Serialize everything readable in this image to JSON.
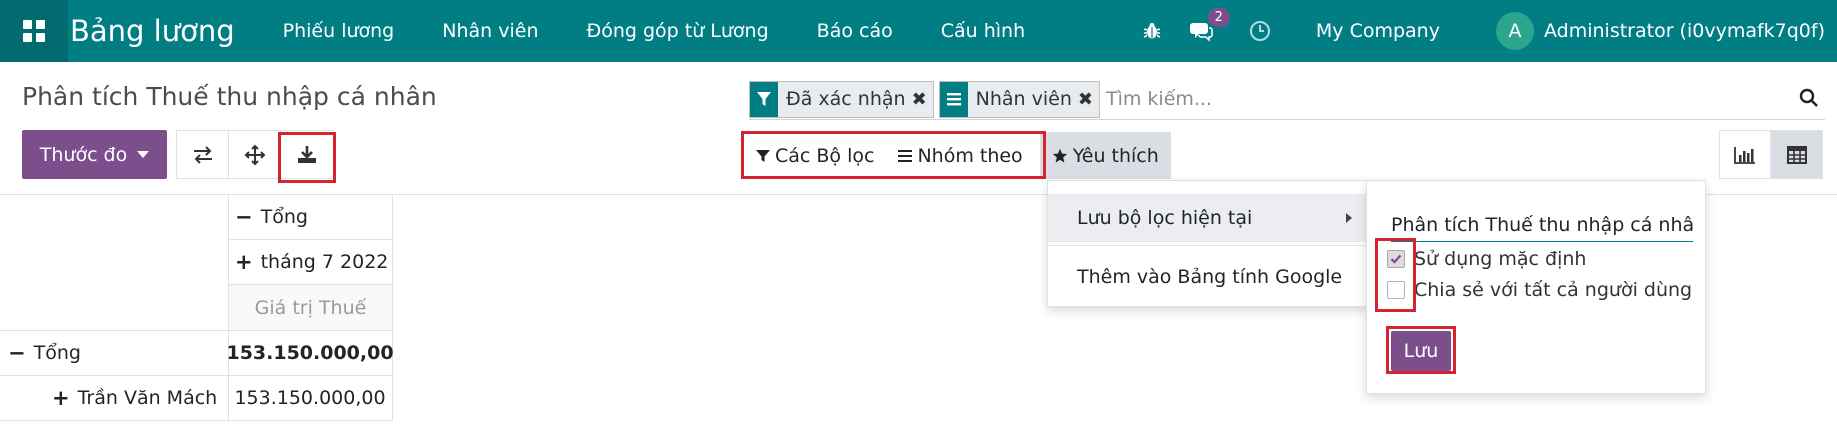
{
  "navbar": {
    "brand": "Bảng lương",
    "menu": [
      "Phiếu lương",
      "Nhân viên",
      "Đóng góp từ Lương",
      "Báo cáo",
      "Cấu hình"
    ],
    "chat_badge": "2",
    "company": "My Company",
    "avatar_letter": "A",
    "user": "Administrator (i0vymafk7q0f)",
    "bg_color": "#017e84"
  },
  "control_panel": {
    "title": "Phân tích Thuế thu nhập cá nhân",
    "measure_label": "Thước đo",
    "facets": [
      {
        "icon": "filter-icon",
        "label": "Đã xác nhận"
      },
      {
        "icon": "group-by-icon",
        "label": "Nhân viên"
      }
    ],
    "search_placeholder": "Tìm kiếm...",
    "filters_label": "Các Bộ lọc",
    "groupby_label": "Nhóm theo",
    "favorites_label": "Yêu thích"
  },
  "pivot": {
    "col_total": "Tổng",
    "col_period": "tháng 7 2022",
    "measure": "Giá trị Thuế",
    "row_total": "Tổng",
    "total_value": "153.150.000,00",
    "rows": [
      {
        "label": "Trần Văn Mách",
        "value": "153.150.000,00"
      }
    ]
  },
  "favorites_menu": {
    "save_current": "Lưu bộ lọc hiện tại",
    "add_google": "Thêm vào Bảng tính Google",
    "name_value": "Phân tích Thuế thu nhập cá nhân",
    "use_default": "Sử dụng mặc định",
    "use_default_checked": true,
    "share_all": "Chia sẻ với tất cả người dùng",
    "share_all_checked": false,
    "save_label": "Lưu"
  },
  "colors": {
    "primary": "#7c4f8c",
    "teal": "#017e84",
    "highlight_red": "#d5232f"
  }
}
